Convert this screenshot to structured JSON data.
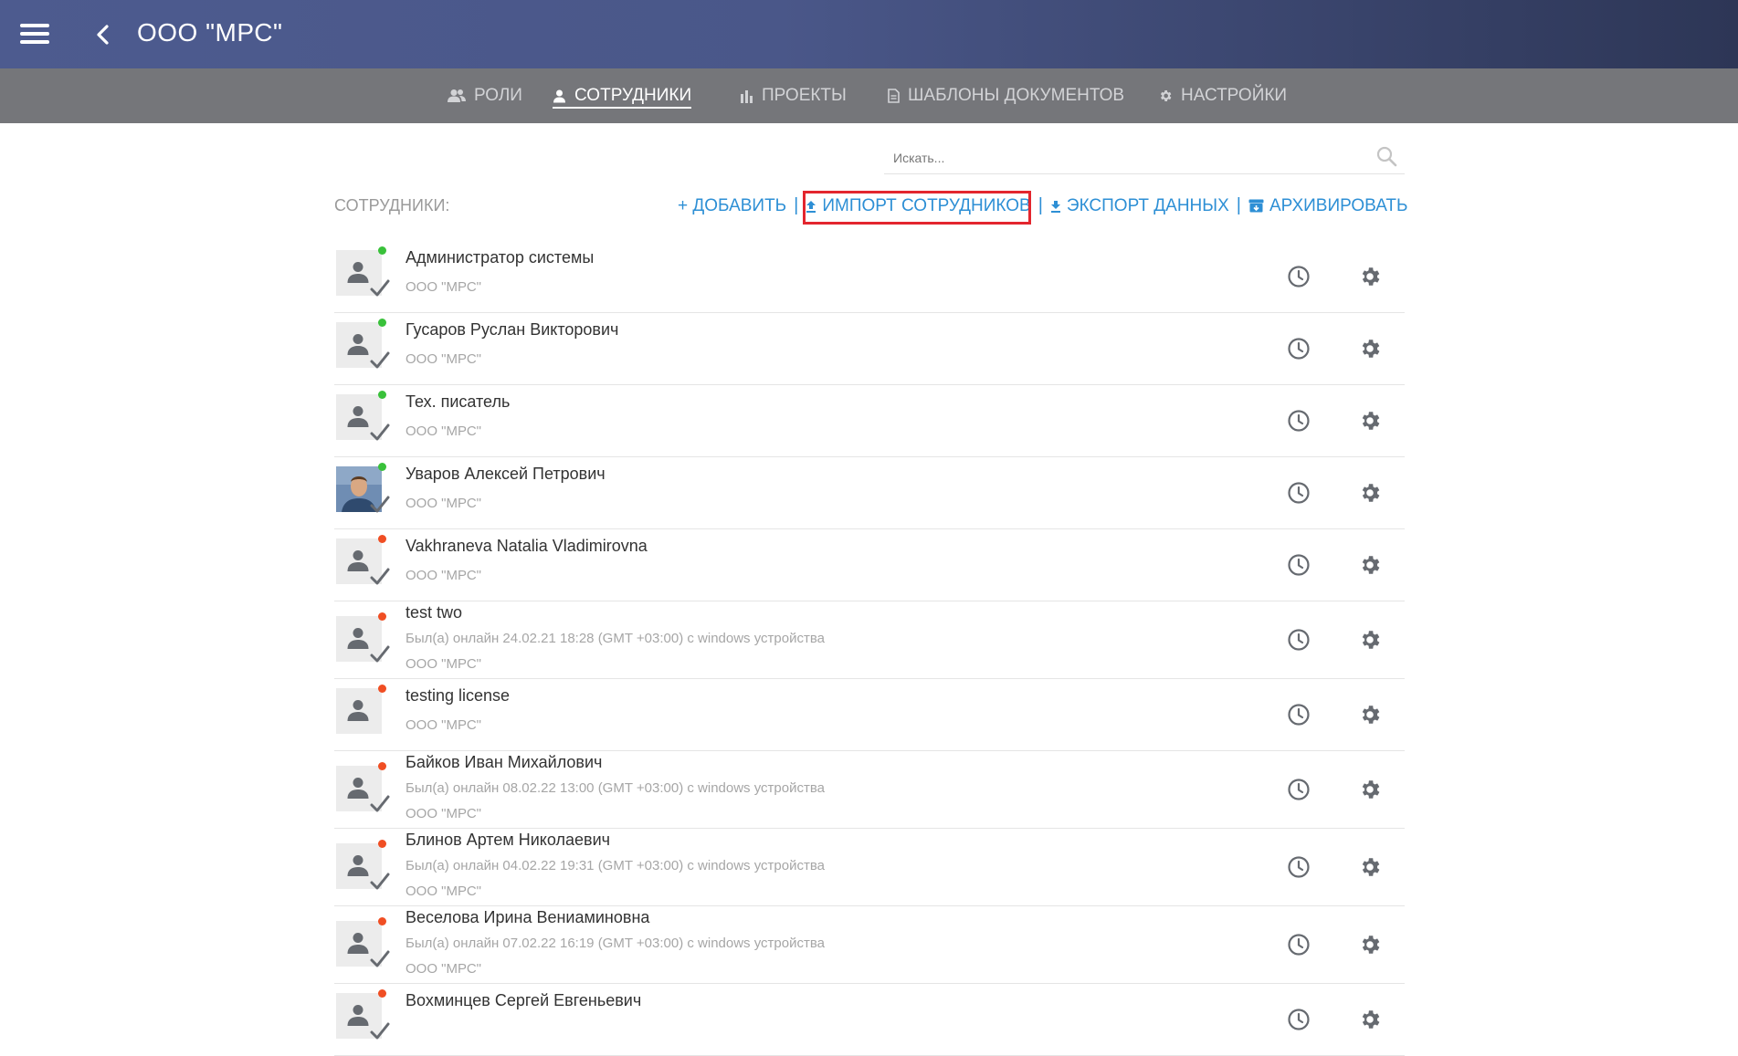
{
  "header": {
    "title": "ООО \"МРС\""
  },
  "tabs": [
    {
      "label": "РОЛИ",
      "icon": "roles-icon"
    },
    {
      "label": "СОТРУДНИКИ",
      "icon": "person-icon",
      "active": true
    },
    {
      "label": "ПРОЕКТЫ",
      "icon": "projects-icon"
    },
    {
      "label": "ШАБЛОНЫ ДОКУМЕНТОВ",
      "icon": "document-icon"
    },
    {
      "label": "НАСТРОЙКИ",
      "icon": "gear-icon"
    }
  ],
  "search": {
    "placeholder": "Искать..."
  },
  "section": {
    "label": "СОТРУДНИКИ:"
  },
  "actions": {
    "add": "+ ДОБАВИТЬ",
    "import": "ИМПОРТ СОТРУДНИКОВ",
    "export": "ЭКСПОРТ ДАННЫХ",
    "archive": "АРХИВИРОВАТЬ"
  },
  "colors": {
    "accent": "#2d8fd5",
    "online": "#39c13a",
    "offline": "#f04e23",
    "highlight": "#e3262e"
  },
  "employees": [
    {
      "name": "Администратор системы",
      "org": "ООО \"МРС\"",
      "status": "online",
      "verified": true
    },
    {
      "name": "Гусаров Руслан Викторович",
      "org": "ООО \"МРС\"",
      "status": "online",
      "verified": true
    },
    {
      "name": "Тех. писатель",
      "org": "ООО \"МРС\"",
      "status": "online",
      "verified": true
    },
    {
      "name": "Уваров Алексей Петрович",
      "org": "ООО \"МРС\"",
      "status": "online",
      "verified": true,
      "photo": true
    },
    {
      "name": "Vakhraneva Natalia Vladimirovna",
      "org": "ООО \"МРС\"",
      "status": "offline",
      "verified": true
    },
    {
      "name": "test two",
      "last_seen": "Был(а) онлайн 24.02.21 18:28 (GMT +03:00) с windows устройства",
      "org": "ООО \"МРС\"",
      "status": "offline",
      "verified": true
    },
    {
      "name": "testing license",
      "org": "ООО \"МРС\"",
      "status": "offline",
      "verified": false
    },
    {
      "name": "Байков Иван Михайлович",
      "last_seen": "Был(а) онлайн 08.02.22 13:00 (GMT +03:00) с windows устройства",
      "org": "ООО \"МРС\"",
      "status": "offline",
      "verified": true
    },
    {
      "name": "Блинов Артем Николаевич",
      "last_seen": "Был(а) онлайн 04.02.22 19:31 (GMT +03:00) с windows устройства",
      "org": "ООО \"МРС\"",
      "status": "offline",
      "verified": true
    },
    {
      "name": "Веселова Ирина Вениаминовна",
      "last_seen": "Был(а) онлайн 07.02.22 16:19 (GMT +03:00) с windows устройства",
      "org": "ООО \"МРС\"",
      "status": "offline",
      "verified": true
    },
    {
      "name": "Вохминцев Сергей Евгеньевич",
      "org": "",
      "status": "offline",
      "verified": true
    }
  ]
}
